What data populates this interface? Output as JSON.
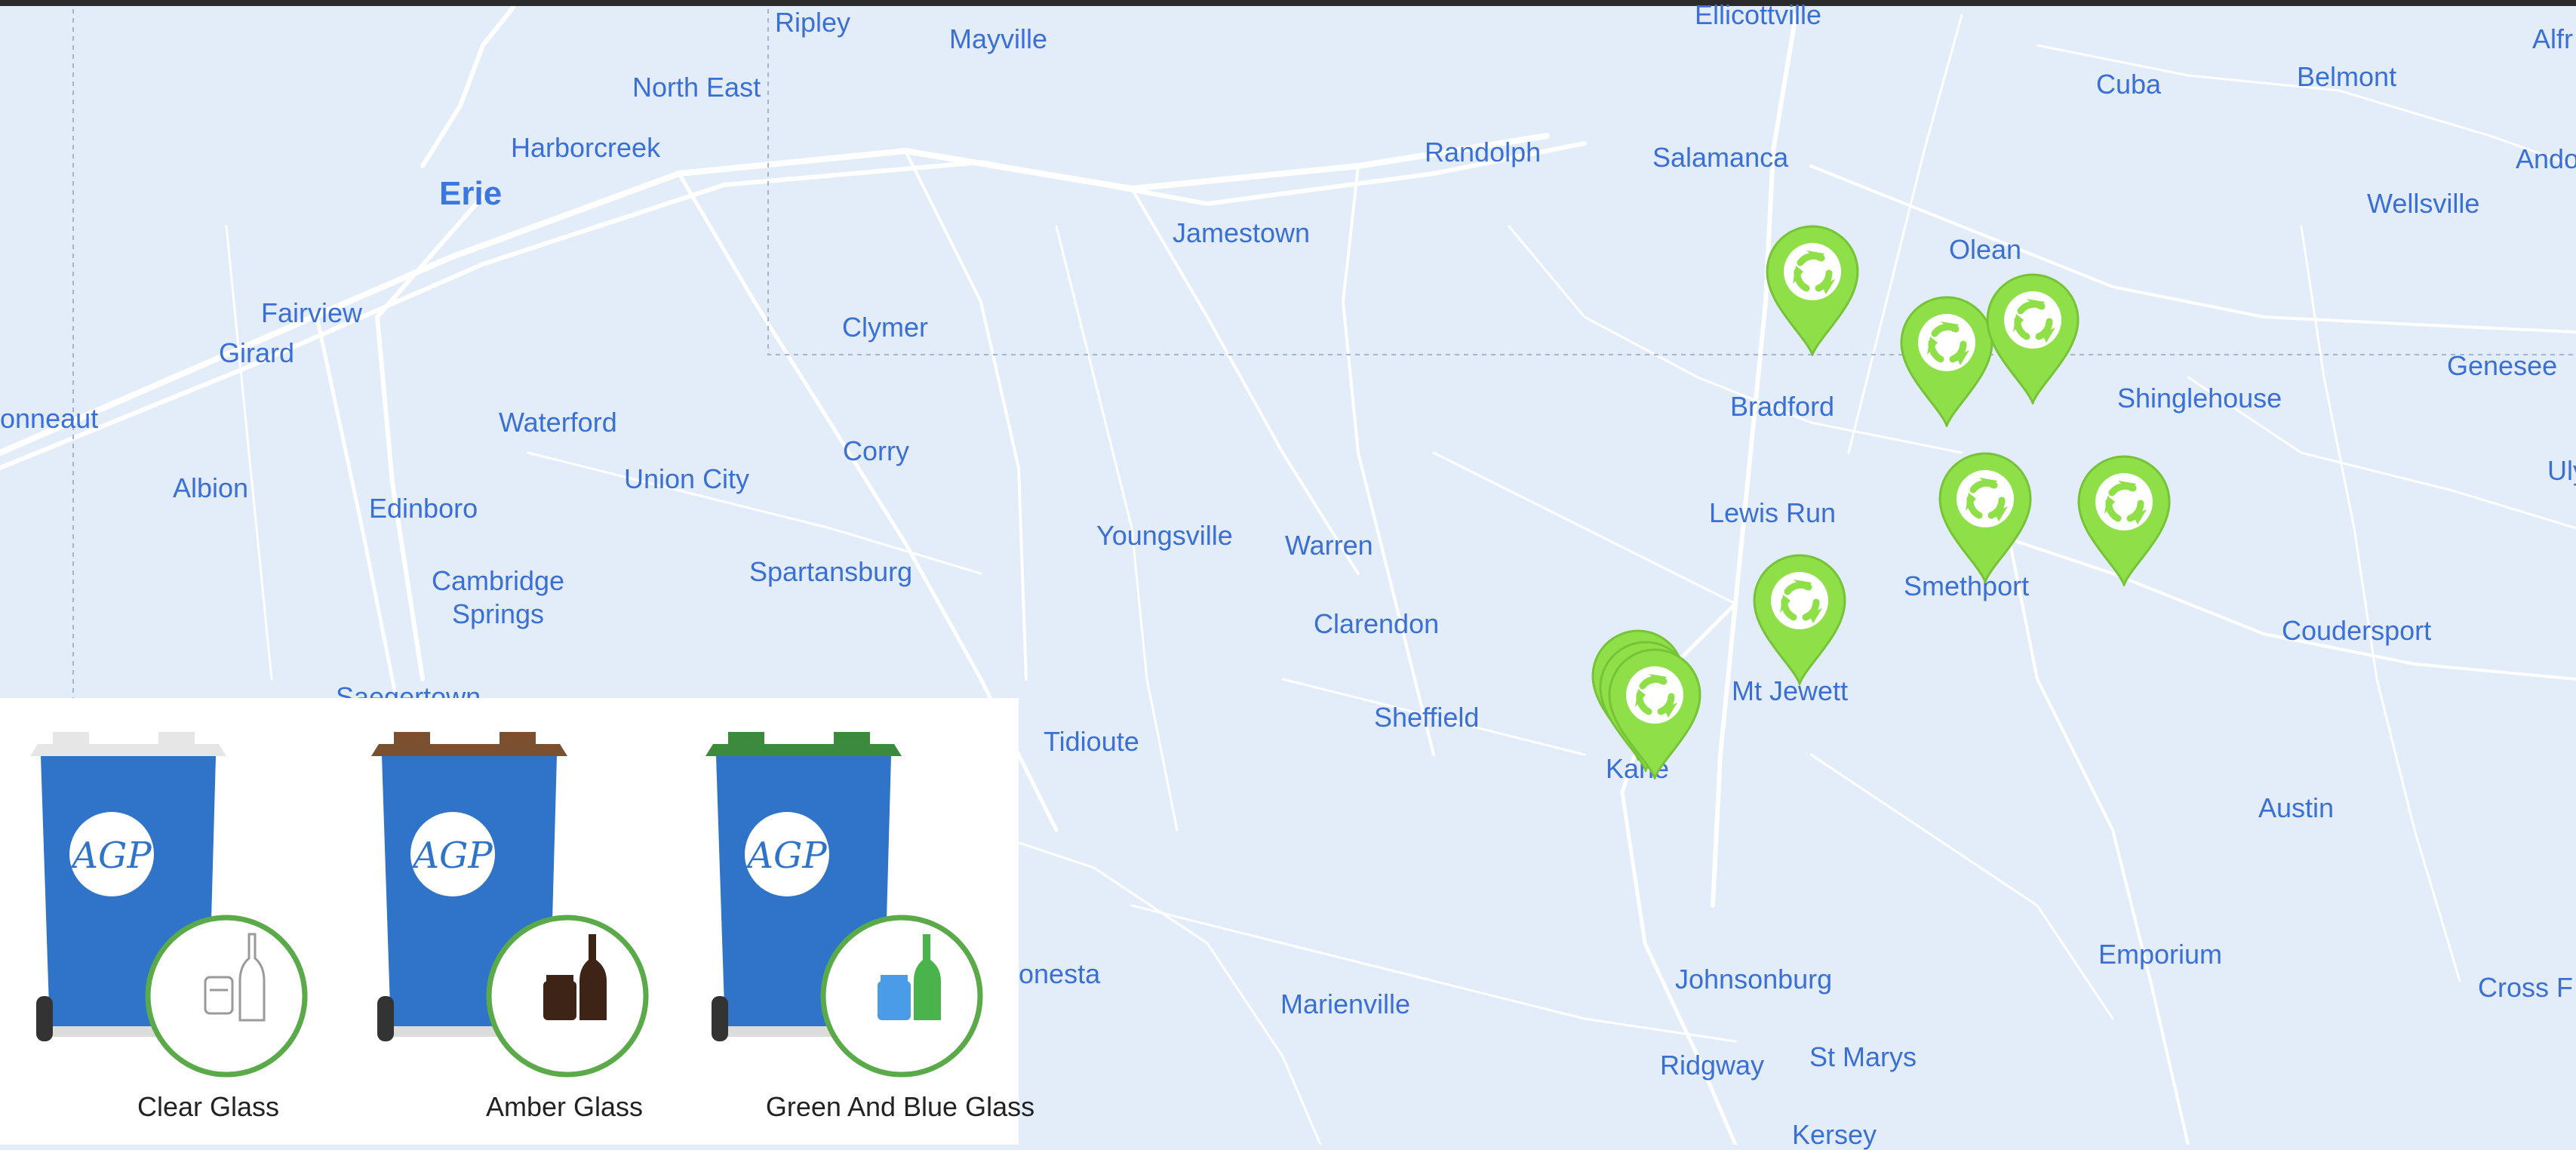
{
  "map": {
    "places": [
      {
        "name": "Ripley"
      },
      {
        "name": "Mayville"
      },
      {
        "name": "Ellicottville"
      },
      {
        "name": "Cuba"
      },
      {
        "name": "Belmont"
      },
      {
        "name": "Alfr"
      },
      {
        "name": "North East"
      },
      {
        "name": "Harborcreek"
      },
      {
        "name": "Erie"
      },
      {
        "name": "Randolph"
      },
      {
        "name": "Salamanca"
      },
      {
        "name": "Ando"
      },
      {
        "name": "Wellsville"
      },
      {
        "name": "Jamestown"
      },
      {
        "name": "Olean"
      },
      {
        "name": "Fairview"
      },
      {
        "name": "Girard"
      },
      {
        "name": "Clymer"
      },
      {
        "name": "Genesee"
      },
      {
        "name": "Bradford"
      },
      {
        "name": "Shinglehouse"
      },
      {
        "name": "onneaut"
      },
      {
        "name": "Waterford"
      },
      {
        "name": "Corry"
      },
      {
        "name": "Uly"
      },
      {
        "name": "Albion"
      },
      {
        "name": "Union City"
      },
      {
        "name": "Edinboro"
      },
      {
        "name": "Lewis Run"
      },
      {
        "name": "Youngsville"
      },
      {
        "name": "Warren"
      },
      {
        "name": "Cambridge Springs"
      },
      {
        "name": "Spartansburg"
      },
      {
        "name": "Smethport"
      },
      {
        "name": "Clarendon"
      },
      {
        "name": "Coudersport"
      },
      {
        "name": "Mt Jewett"
      },
      {
        "name": "Saegertown"
      },
      {
        "name": "Sheffield"
      },
      {
        "name": "Tidioute"
      },
      {
        "name": "Kane"
      },
      {
        "name": "Austin"
      },
      {
        "name": "onesta"
      },
      {
        "name": "Emporium"
      },
      {
        "name": "Johnsonburg"
      },
      {
        "name": "Cross F"
      },
      {
        "name": "Marienville"
      },
      {
        "name": "St Marys"
      },
      {
        "name": "Ridgway"
      },
      {
        "name": "Kersey"
      }
    ],
    "marker_icon": "recycling-pin-icon",
    "marker_color": "#8fdf48",
    "marker_count": 9
  },
  "legend": {
    "bins": [
      {
        "label": "Clear Glass",
        "lid_color": "#e6e6e6",
        "glass_color": "clear"
      },
      {
        "label": "Amber Glass",
        "lid_color": "#7a5030",
        "glass_color": "#3d2417"
      },
      {
        "label": "Green And Blue Glass",
        "lid_color": "#3b8a3e",
        "glass_color": "#4bb34b"
      }
    ],
    "logo_text": "AGP"
  },
  "colors": {
    "map_background": "#e3edfa",
    "road": "#ffffff",
    "bin_body": "#2f74c8",
    "label": "#3a6fd6"
  }
}
